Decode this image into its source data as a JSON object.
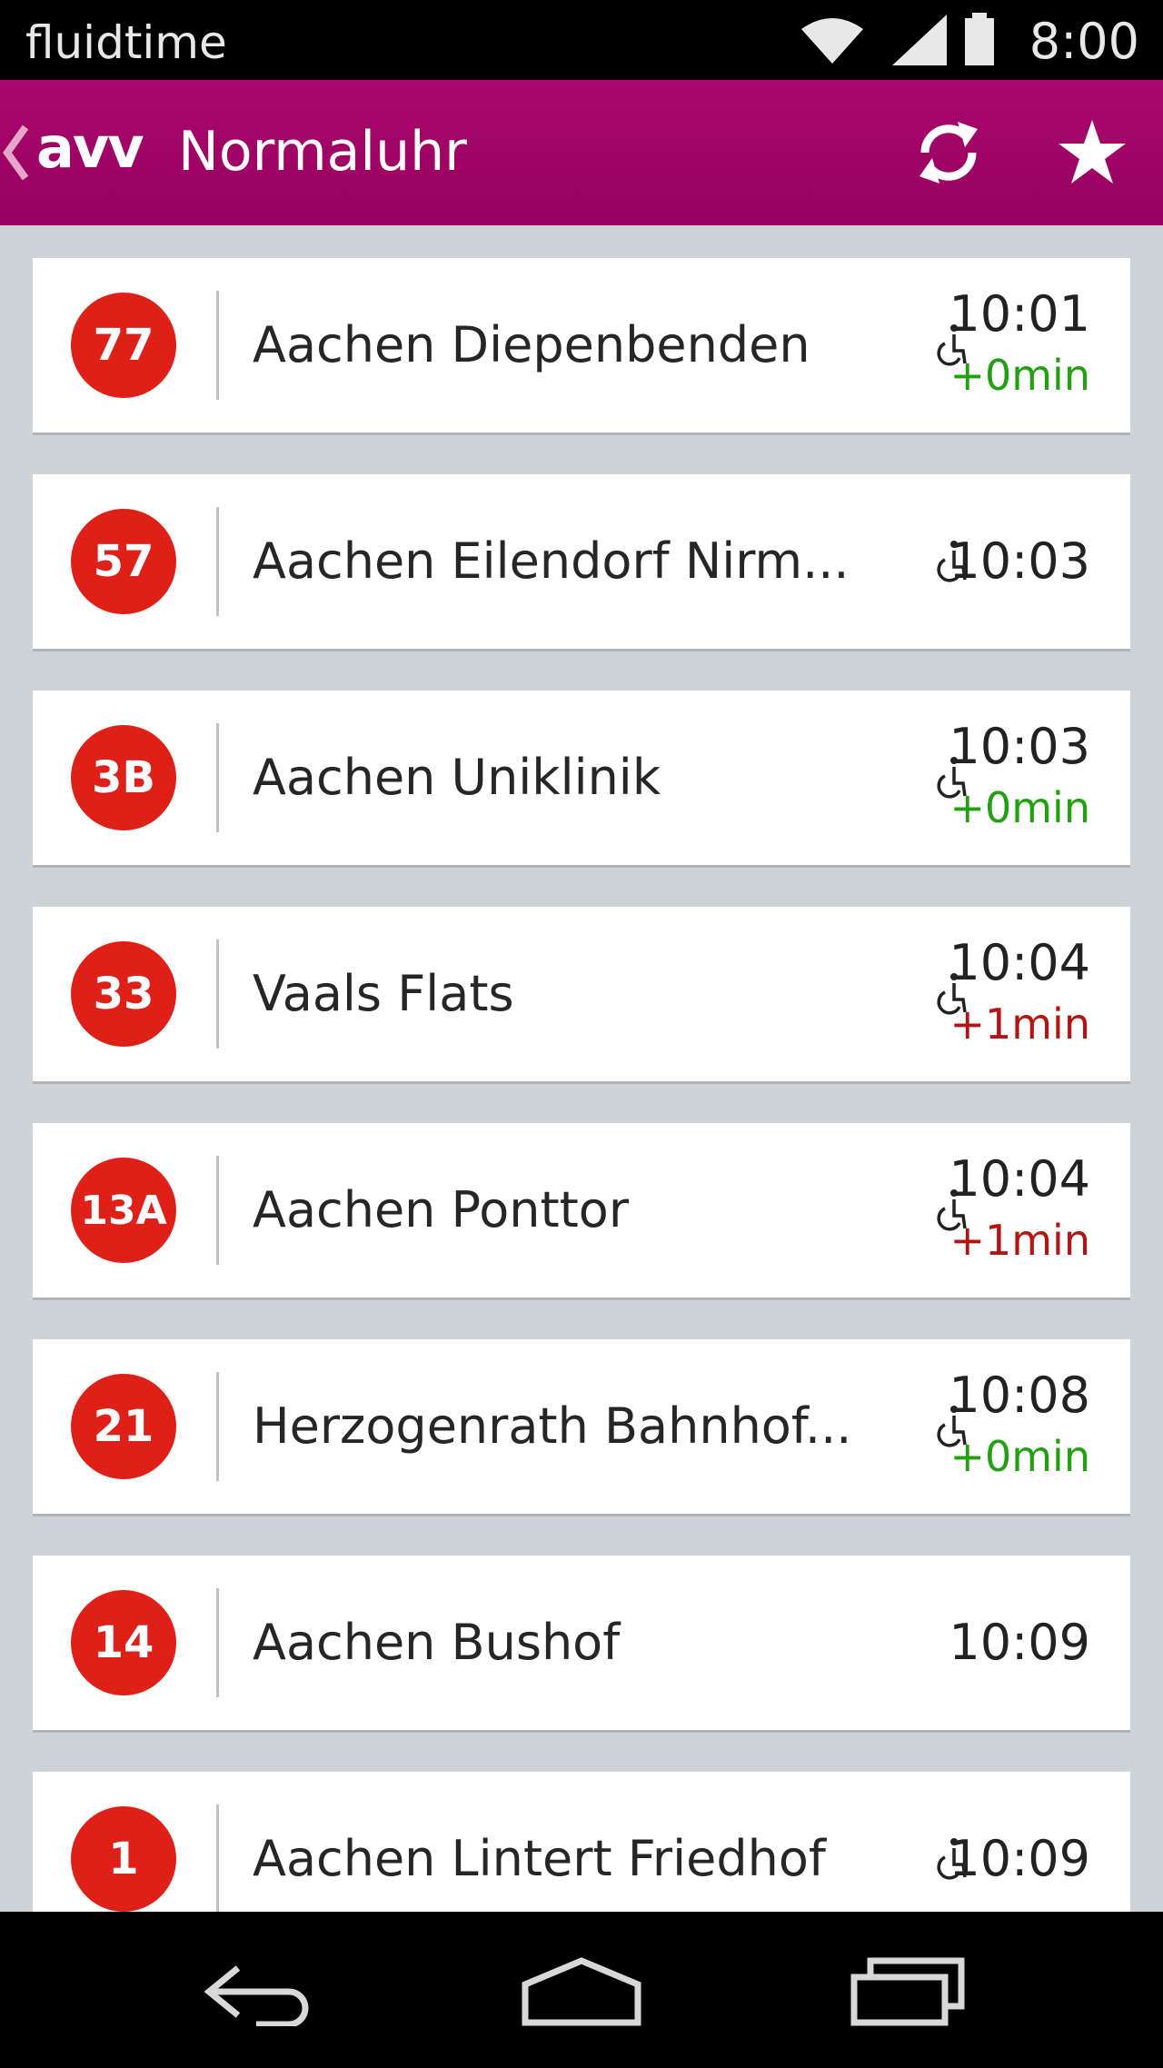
{
  "status_bar": {
    "carrier": "fluidtime",
    "time": "8:00",
    "icons": [
      "wifi-icon",
      "signal-icon",
      "battery-icon"
    ]
  },
  "action_bar": {
    "logo": "avv",
    "title": "Normaluhr",
    "actions": [
      "refresh-icon",
      "star-icon"
    ],
    "background": "#a0066a"
  },
  "colors": {
    "badge": "#df2019",
    "on_time": "#22a012",
    "late": "#b21613"
  },
  "departures": [
    {
      "line": "77",
      "destination": "Aachen Diepenbenden",
      "time": "10:01",
      "delay": "+0min",
      "delay_status": "on-time",
      "accessible": true
    },
    {
      "line": "57",
      "destination": "Aachen Eilendorf Nirm...",
      "time": "10:03",
      "delay": "",
      "delay_status": "",
      "accessible": true
    },
    {
      "line": "3B",
      "destination": "Aachen Uniklinik",
      "time": "10:03",
      "delay": "+0min",
      "delay_status": "on-time",
      "accessible": true
    },
    {
      "line": "33",
      "destination": "Vaals Flats",
      "time": "10:04",
      "delay": "+1min",
      "delay_status": "late",
      "accessible": true
    },
    {
      "line": "13A",
      "destination": "Aachen Ponttor",
      "time": "10:04",
      "delay": "+1min",
      "delay_status": "late",
      "accessible": true
    },
    {
      "line": "21",
      "destination": "Herzogenrath Bahnhof...",
      "time": "10:08",
      "delay": "+0min",
      "delay_status": "on-time",
      "accessible": true
    },
    {
      "line": "14",
      "destination": "Aachen Bushof",
      "time": "10:09",
      "delay": "",
      "delay_status": "",
      "accessible": false
    },
    {
      "line": "1",
      "destination": "Aachen Lintert Friedhof",
      "time": "10:09",
      "delay": "",
      "delay_status": "",
      "accessible": true
    }
  ],
  "nav_bar": {
    "buttons": [
      "back-icon",
      "home-icon",
      "recents-icon"
    ]
  }
}
